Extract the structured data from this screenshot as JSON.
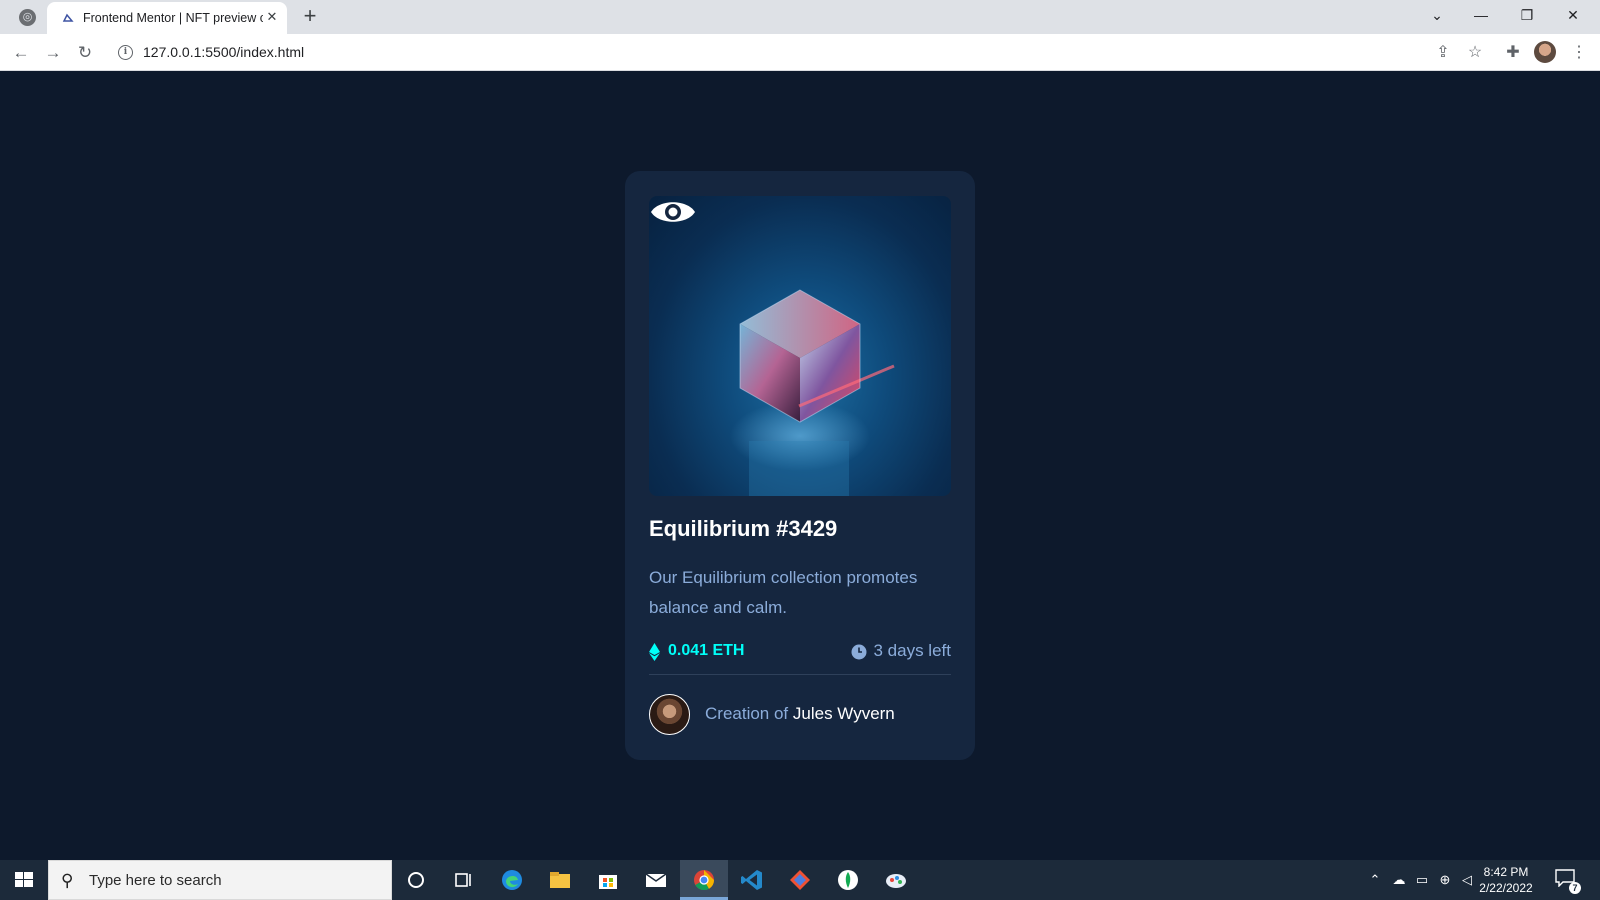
{
  "browser": {
    "tab_title": "Frontend Mentor | NFT preview c",
    "url": "127.0.0.1:5500/index.html",
    "new_tab_label": "+",
    "close_tab_label": "✕",
    "window": {
      "minimize": "—",
      "restore": "❐",
      "close": "✕"
    }
  },
  "card": {
    "title": "Equilibrium #3429",
    "description": "Our Equilibrium collection promotes balance and calm.",
    "price": "0.041 ETH",
    "time_left": "3 days left",
    "creator_prefix": "Creation of ",
    "creator_name": "Jules Wyvern"
  },
  "colors": {
    "page_bg": "#0d192c",
    "card_bg": "#15263f",
    "cyan": "#00fff8",
    "soft_blue": "#8bacda",
    "white": "#ffffff"
  },
  "taskbar": {
    "search_placeholder": "Type here to search",
    "time": "8:42 PM",
    "date": "2/22/2022",
    "notification_count": "7",
    "apps": [
      "cortana-icon",
      "task-view-icon",
      "edge-icon",
      "file-explorer-icon",
      "store-icon",
      "mail-icon",
      "chrome-icon",
      "vscode-icon",
      "git-icon",
      "mongodb-icon",
      "paint-icon"
    ]
  }
}
